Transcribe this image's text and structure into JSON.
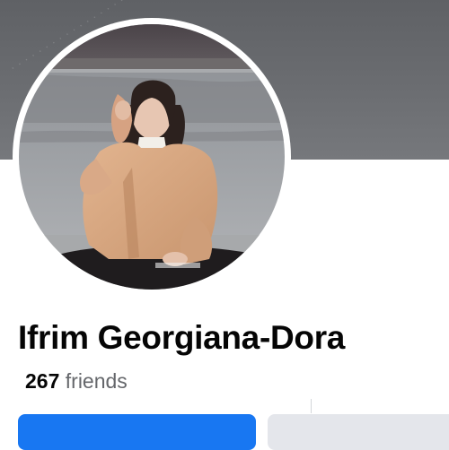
{
  "profile": {
    "name": "Ifrim Georgiana-Dora",
    "friends_count": "267",
    "friends_label": "friends"
  },
  "colors": {
    "primary_button": "#1877f2",
    "secondary_button": "#e4e6eb",
    "name_text": "#050505",
    "muted_text": "#65676b"
  }
}
